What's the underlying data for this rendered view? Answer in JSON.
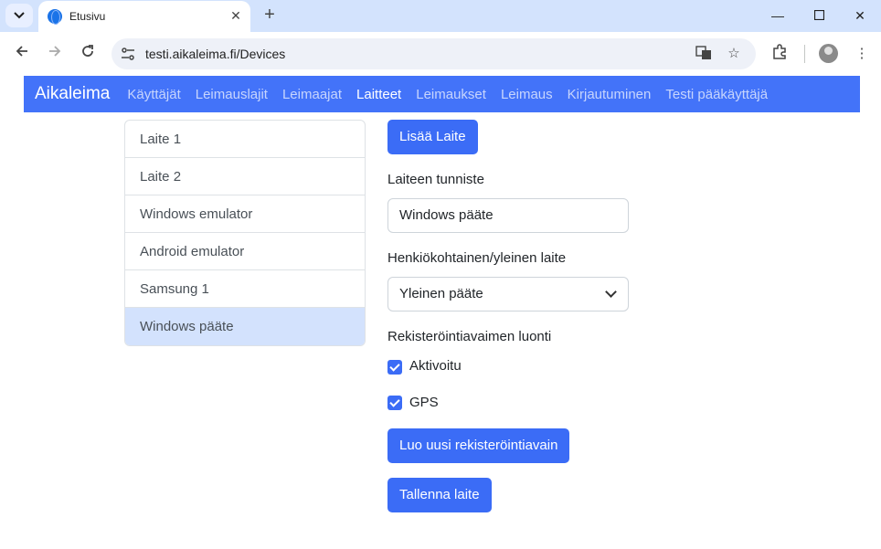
{
  "browser": {
    "tab_title": "Etusivu",
    "url": "testi.aikaleima.fi/Devices"
  },
  "app": {
    "brand": "Aikaleima",
    "nav": [
      {
        "label": "Käyttäjät"
      },
      {
        "label": "Leimauslajit"
      },
      {
        "label": "Leimaajat"
      },
      {
        "label": "Laitteet"
      },
      {
        "label": "Leimaukset"
      },
      {
        "label": "Leimaus"
      },
      {
        "label": "Kirjautuminen"
      },
      {
        "label": "Testi pääkäyttäjä"
      }
    ],
    "active_nav": "Laitteet"
  },
  "devices": {
    "items": [
      {
        "label": "Laite 1"
      },
      {
        "label": "Laite 2"
      },
      {
        "label": "Windows emulator"
      },
      {
        "label": "Android emulator"
      },
      {
        "label": "Samsung 1"
      },
      {
        "label": "Windows pääte"
      }
    ],
    "selected": "Windows pääte"
  },
  "form": {
    "add_button": "Lisää Laite",
    "id_label": "Laiteen tunniste",
    "id_value": "Windows pääte",
    "type_label": "Henkiökohtainen/yleinen laite",
    "type_value": "Yleinen pääte",
    "reg_label": "Rekisteröintiavaimen luonti",
    "activated_label": "Aktivoitu",
    "activated_checked": true,
    "gps_label": "GPS",
    "gps_checked": true,
    "new_key_button": "Luo uusi rekisteröintiavain",
    "save_button": "Tallenna laite"
  },
  "colors": {
    "navbar": "#4373f9",
    "primary_button": "#3b6cf6",
    "selected_item": "#d3e2fd"
  }
}
